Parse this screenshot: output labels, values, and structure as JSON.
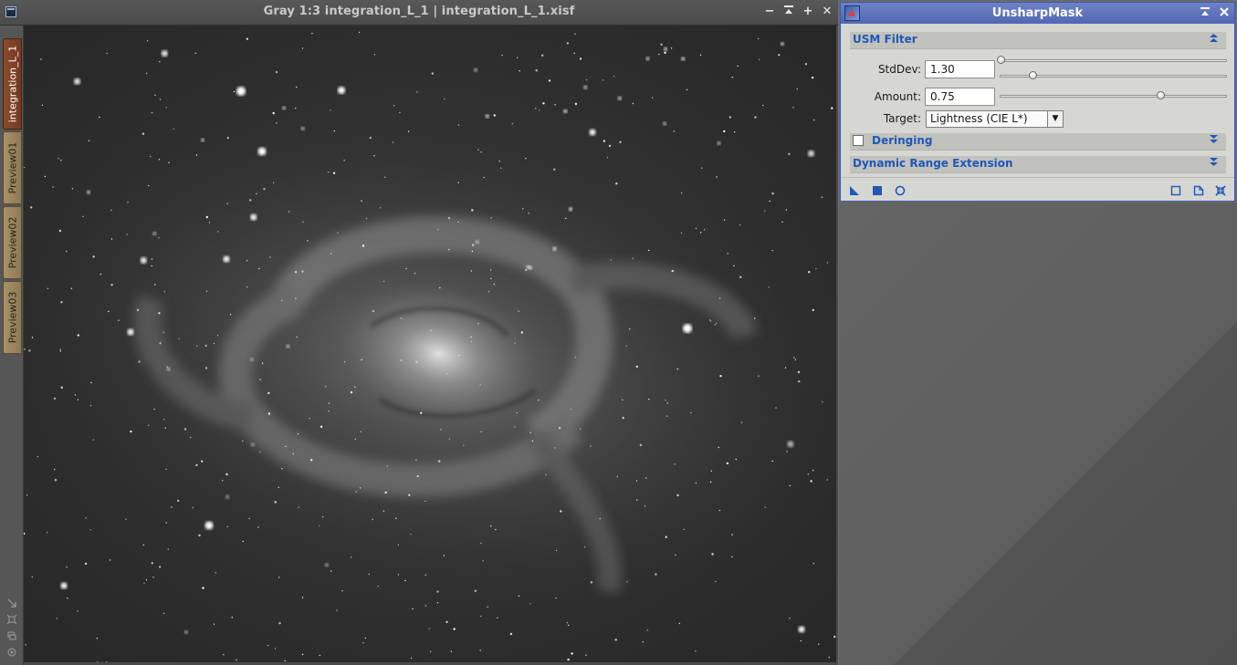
{
  "image_window": {
    "title": "Gray 1:3 integration_L_1 | integration_L_1.xisf",
    "controls": {
      "minimize": "−",
      "shade": "⌃",
      "maximize": "+",
      "close": "✕"
    },
    "tabs": [
      {
        "label": "integration_L_1",
        "active": true
      },
      {
        "label": "Preview01",
        "active": false
      },
      {
        "label": "Preview02",
        "active": false
      },
      {
        "label": "Preview03",
        "active": false
      }
    ]
  },
  "dialog": {
    "title": "UnsharpMask",
    "sections": {
      "usm_filter": "USM Filter",
      "deringing": "Deringing",
      "dre": "Dynamic Range Extension"
    },
    "params": {
      "stddev_label": "StdDev:",
      "stddev_value": "1.30",
      "amount_label": "Amount:",
      "amount_value": "0.75",
      "target_label": "Target:",
      "target_value": "Lightness (CIE L*)"
    },
    "slider_levels": {
      "stddev_coarse": 0.0,
      "stddev_fine": 0.14,
      "amount": 0.71
    },
    "deringing_checked": false,
    "colors": {
      "accent": "#1f58b8",
      "titlebar": "#5267b3",
      "panel": "#d6d6d2"
    }
  }
}
